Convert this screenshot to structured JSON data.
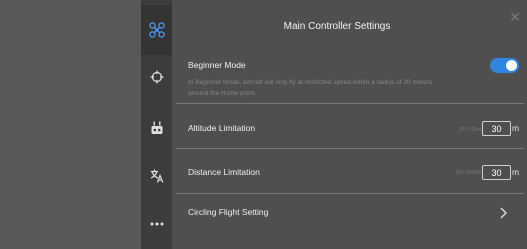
{
  "sidebar": {
    "items": [
      {
        "icon": "drone-icon",
        "active": true
      },
      {
        "icon": "crosshair-icon",
        "active": false
      },
      {
        "icon": "remote-controller-icon",
        "active": false
      },
      {
        "icon": "translate-icon",
        "active": false
      },
      {
        "icon": "more-icon",
        "active": false
      }
    ]
  },
  "panel": {
    "title": "Main Controller Settings",
    "close_icon": "close-icon",
    "beginner_mode": {
      "label": "Beginner Mode",
      "enabled": true,
      "description": "In Beginner Mode, aircraft will only fly at restricted speed within a radius of 30 meters around the Home point."
    },
    "altitude_limitation": {
      "label": "Altitude Limitation",
      "range_hint": "(20~120m)",
      "value": "30",
      "unit": "m"
    },
    "distance_limitation": {
      "label": "Distance Limitation",
      "range_hint": "(20~2000m)",
      "value": "30",
      "unit": "m"
    },
    "circling_flight": {
      "label": "Circling Flight Setting",
      "chevron_icon": "chevron-right-icon"
    }
  },
  "colors": {
    "toggle_on": "#2e86e0",
    "panel_bg": "#4f4f4f",
    "rail_bg": "#3c3c3c",
    "active_icon": "#4d9fff"
  }
}
